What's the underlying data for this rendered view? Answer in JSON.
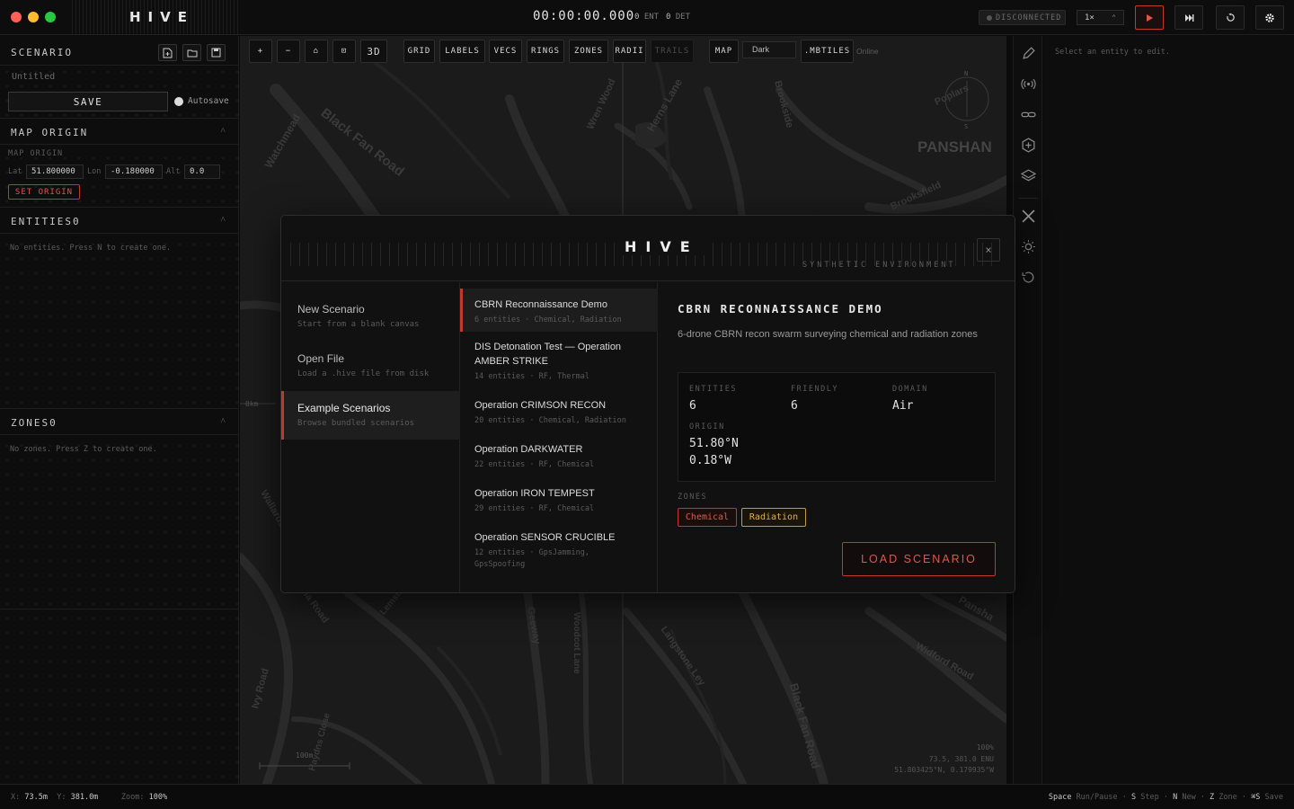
{
  "app": {
    "name": "HIVE",
    "clock": "00:00:00.000",
    "ent_count": "0",
    "ent_label": "ENT",
    "det_count": "0",
    "det_label": "DET",
    "connection": "DISCONNECTED",
    "speed": "1×",
    "traffic_colors": [
      "#ff5f57",
      "#febc2e",
      "#28c840"
    ]
  },
  "left": {
    "scenario": {
      "title": "SCENARIO",
      "name": "Untitled",
      "save": "SAVE",
      "autosave": "Autosave"
    },
    "origin": {
      "title": "MAP ORIGIN",
      "sublabel": "MAP ORIGIN",
      "lat_label": "Lat",
      "lat": "51.800000",
      "lon_label": "Lon",
      "lon": "-0.180000",
      "alt_label": "Alt",
      "alt": "0.0",
      "set_origin": "SET ORIGIN"
    },
    "entities": {
      "title": "ENTITIES",
      "count": "0",
      "empty": "No entities. Press N to create one."
    },
    "zones": {
      "title": "ZONES",
      "count": "0",
      "empty": "No zones. Press Z to create one."
    }
  },
  "toolbar": {
    "zoom_in": "+",
    "zoom_out": "−",
    "home": "⌂",
    "fit": "⊡",
    "mode_3d": "3D",
    "grid": "GRID",
    "labels": "LABELS",
    "vecs": "VECS",
    "rings": "RINGS",
    "zones": "ZONES",
    "radii": "RADII",
    "trails": "TRAILS",
    "map": "MAP",
    "theme": "Dark",
    "mbtiles": ".MBTILES",
    "online": "Online"
  },
  "map": {
    "labels": [
      "Black Fan Road",
      "Watchmead",
      "Herns Lane",
      "Wren Wood",
      "Poplars",
      "Brookside",
      "PANSHAN",
      "Brooksfield",
      "Wallards",
      "Knella Road",
      "Geeway",
      "Woodcot Lane",
      "Langstone Ley",
      "Black Fan Road",
      "Widford Road",
      "Pansha",
      "Haydns Close",
      "Ivy Road",
      "Lemsford"
    ],
    "scale_left": "0km",
    "scale_bottom": "100m",
    "zoom_readout": "100%",
    "local_coords": "73.5, 381.0 ENU",
    "geo_coords": "51.803425°N, 0.179935°W",
    "compass_n": "N",
    "compass_s": "S"
  },
  "right_panel": {
    "hint": "Select an entity to edit."
  },
  "status": {
    "x_label": "X:",
    "x": "73.5m",
    "y_label": "Y:",
    "y": "381.0m",
    "zoom_label": "Zoom:",
    "zoom": "100%",
    "shortcuts": [
      {
        "key": "Space",
        "action": "Run/Pause"
      },
      {
        "key": "S",
        "action": "Step"
      },
      {
        "key": "N",
        "action": "New"
      },
      {
        "key": "Z",
        "action": "Zone"
      },
      {
        "key": "⌘S",
        "action": "Save"
      }
    ]
  },
  "modal": {
    "logo": "HIVE",
    "subtitle": "SYNTHETIC ENVIRONMENT",
    "close": "×",
    "nav": [
      {
        "title": "New Scenario",
        "desc": "Start from a blank canvas"
      },
      {
        "title": "Open File",
        "desc": "Load a .hive file from disk"
      },
      {
        "title": "Example Scenarios",
        "desc": "Browse bundled scenarios"
      }
    ],
    "scenarios": [
      {
        "title": "CBRN Reconnaissance Demo",
        "meta": "6 entities · Chemical, Radiation"
      },
      {
        "title": "DIS Detonation Test — Operation AMBER STRIKE",
        "meta": "14 entities · RF, Thermal"
      },
      {
        "title": "Operation CRIMSON RECON",
        "meta": "20 entities · Chemical, Radiation"
      },
      {
        "title": "Operation DARKWATER",
        "meta": "22 entities · RF, Chemical"
      },
      {
        "title": "Operation IRON TEMPEST",
        "meta": "29 entities · RF, Chemical"
      },
      {
        "title": "Operation SENSOR CRUCIBLE",
        "meta": "12 entities · GpsJamming, GpsSpoofing"
      }
    ],
    "detail": {
      "title": "CBRN RECONNAISSANCE DEMO",
      "desc": "6-drone CBRN recon swarm surveying chemical and radiation zones",
      "entities_label": "ENTITIES",
      "entities": "6",
      "friendly_label": "FRIENDLY",
      "friendly": "6",
      "domain_label": "DOMAIN",
      "domain": "Air",
      "origin_label": "ORIGIN",
      "origin_lat": "51.80°N",
      "origin_lon": "0.18°W",
      "zones_label": "ZONES",
      "zones": [
        "Chemical",
        "Radiation"
      ],
      "load": "LOAD SCENARIO"
    }
  },
  "colors": {
    "accent_red": "#c0392b",
    "chemical": "#e0574a",
    "radiation": "#e0b04a"
  }
}
